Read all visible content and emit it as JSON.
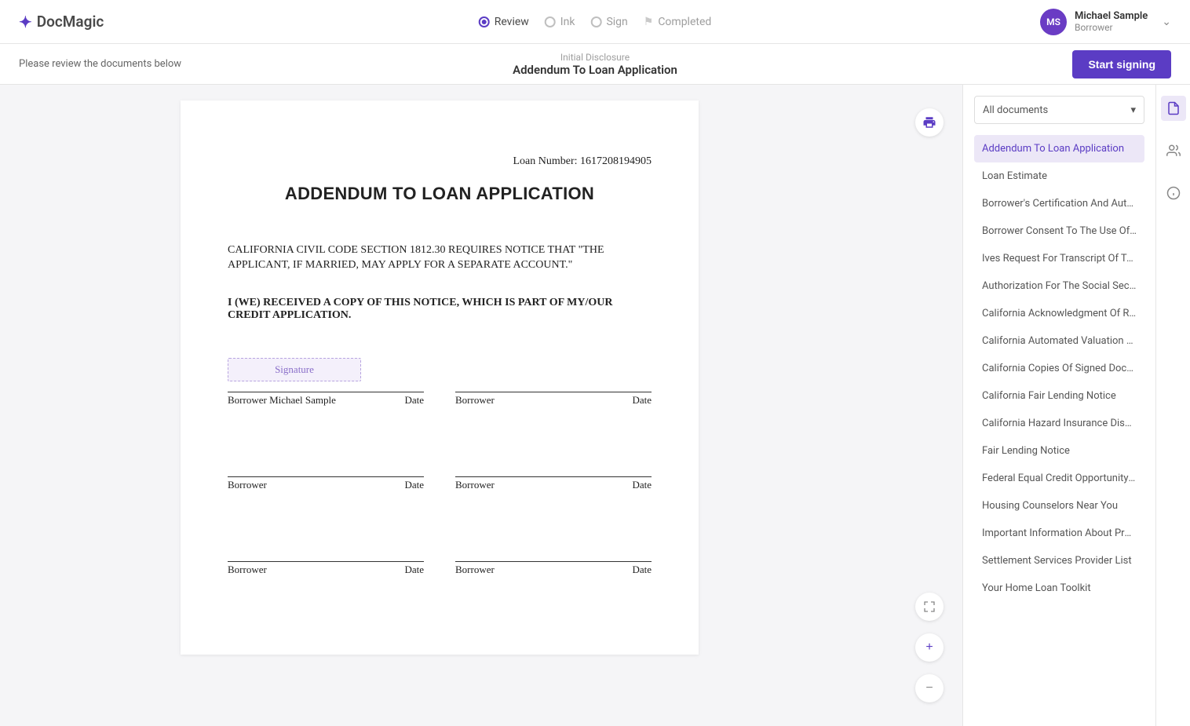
{
  "brand": "DocMagic",
  "steps": [
    {
      "label": "Review",
      "active": true,
      "type": "circle"
    },
    {
      "label": "Ink",
      "active": false,
      "type": "circle"
    },
    {
      "label": "Sign",
      "active": false,
      "type": "circle"
    },
    {
      "label": "Completed",
      "active": false,
      "type": "flag"
    }
  ],
  "user": {
    "initials": "MS",
    "name": "Michael Sample",
    "role": "Borrower"
  },
  "subheader": {
    "instruction": "Please review the documents below",
    "category": "Initial Disclosure",
    "title": "Addendum To Loan Application",
    "cta": "Start signing"
  },
  "document": {
    "loan_number_label": "Loan Number:",
    "loan_number": "1617208194905",
    "title": "ADDENDUM TO LOAN APPLICATION",
    "notice": "CALIFORNIA CIVIL CODE SECTION 1812.30 REQUIRES NOTICE THAT \"THE APPLICANT, IF MARRIED, MAY APPLY FOR A SEPARATE ACCOUNT.\"",
    "ack": "I (WE) RECEIVED A COPY OF THIS NOTICE, WHICH IS PART OF MY/OUR CREDIT APPLICATION.",
    "signature_placeholder": "Signature",
    "sig_blocks": [
      {
        "left": "Borrower Michael Sample",
        "right": "Date",
        "has_placeholder": true
      },
      {
        "left": "Borrower",
        "right": "Date",
        "has_placeholder": false
      },
      {
        "left": "Borrower",
        "right": "Date",
        "has_placeholder": false
      },
      {
        "left": "Borrower",
        "right": "Date",
        "has_placeholder": false
      },
      {
        "left": "Borrower",
        "right": "Date",
        "has_placeholder": false
      },
      {
        "left": "Borrower",
        "right": "Date",
        "has_placeholder": false
      }
    ]
  },
  "sidebar": {
    "filter": "All documents",
    "docs": [
      "Addendum To Loan Application",
      "Loan Estimate",
      "Borrower's Certification And Authorization",
      "Borrower Consent To The Use Of Tax Retur...",
      "Ives Request For Transcript Of Tax Return",
      "Authorization For The Social Security Admi...",
      "California Acknowledgment Of Receipt Of ...",
      "California Automated Valuation Model Not...",
      "California Copies Of Signed Documents",
      "California Fair Lending Notice",
      "California Hazard Insurance Disclosure",
      "Fair Lending Notice",
      "Federal Equal Credit Opportunity Act Notic...",
      "Housing Counselors Near You",
      "Important Information About Procedures F...",
      "Settlement Services Provider List",
      "Your Home Loan Toolkit"
    ],
    "active_index": 0
  }
}
